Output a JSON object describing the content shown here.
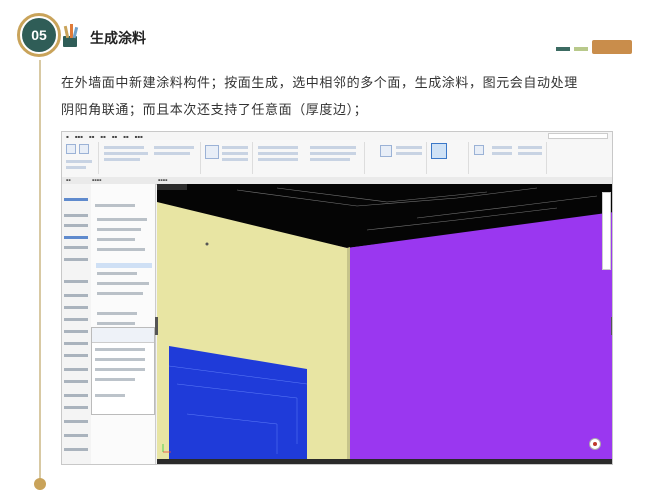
{
  "badge": {
    "number": "05"
  },
  "section": {
    "title": "生成涂料"
  },
  "description": {
    "line1": "在外墙面中新建涂料构件；按面生成，选中相邻的多个面，生成涂料，图元会自动处理",
    "line2": "阴阳角联通；而且本次还支持了任意面（厚度边）；"
  },
  "colors": {
    "badge_fill": "#2f5d57",
    "badge_ring": "#c9a35a",
    "viewport_purple": "#9a37f0",
    "wall_cream": "#e8e5a3",
    "opening_blue": "#1f3bd9"
  },
  "icons": [
    "pencil-cup-icon",
    "deco-bars-icon",
    "user-avatar-icon"
  ]
}
